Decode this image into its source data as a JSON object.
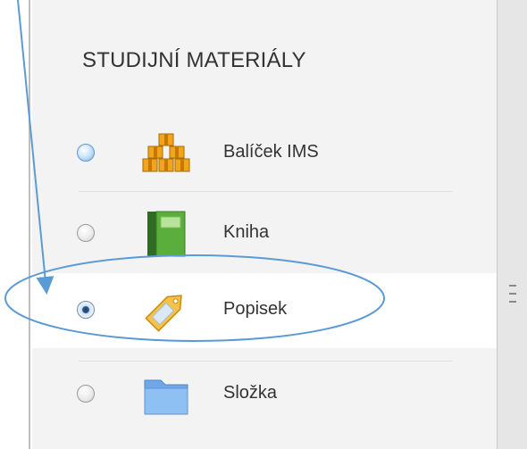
{
  "section": {
    "title": "STUDIJNÍ MATERIÁLY"
  },
  "items": [
    {
      "label": "Balíček IMS",
      "icon": "ims-package-icon",
      "state": "focused"
    },
    {
      "label": "Kniha",
      "icon": "book-icon",
      "state": "unselected"
    },
    {
      "label": "Popisek",
      "icon": "label-tag-icon",
      "state": "selected"
    },
    {
      "label": "Složka",
      "icon": "folder-icon",
      "state": "unselected"
    }
  ],
  "colors": {
    "panel_background": "#f3f3f3",
    "selected_row": "#ffffff",
    "annotation": "#5b9bd5"
  }
}
